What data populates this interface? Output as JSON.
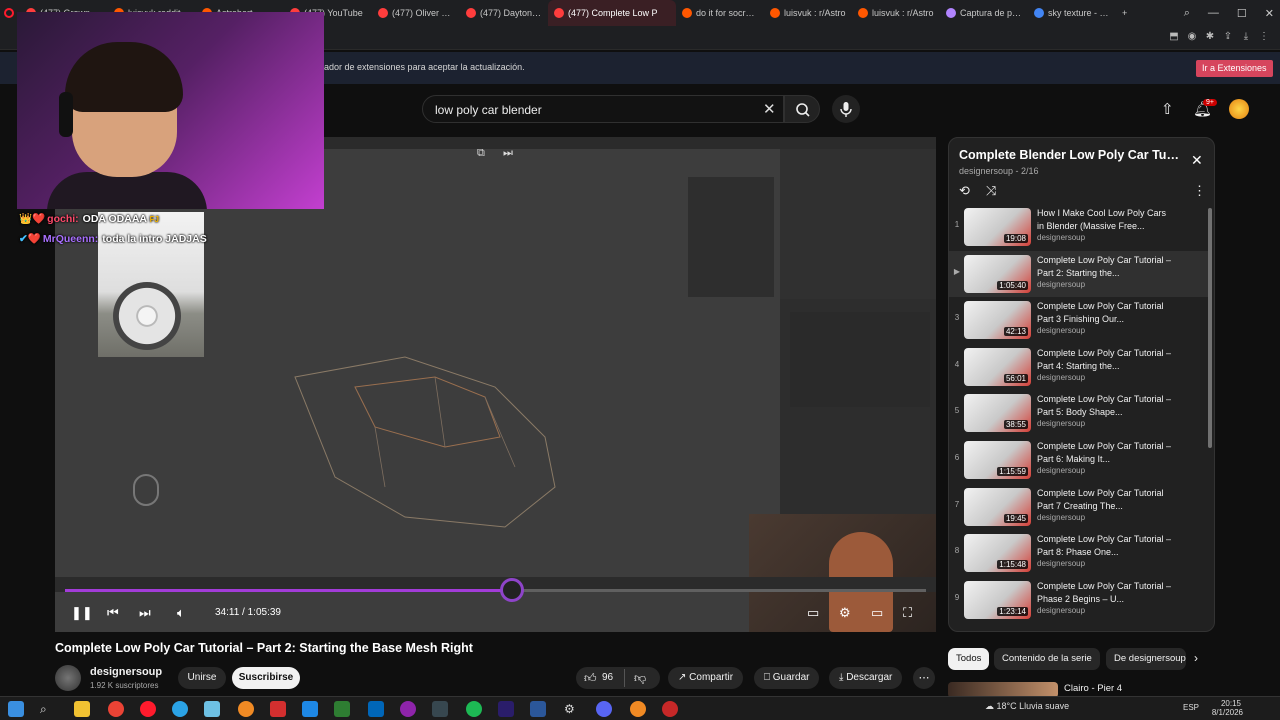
{
  "browser": {
    "tabs": [
      {
        "label": "(477) Grown Up",
        "icon": "youtube-icon",
        "color": "#ff3d3d"
      },
      {
        "label": "luisvuk reddit",
        "icon": "reddit-icon",
        "color": "#ff5700"
      },
      {
        "label": "Astrobort",
        "icon": "reddit-icon",
        "color": "#ff5700"
      },
      {
        "label": "(477) YouTube",
        "icon": "youtube-icon",
        "color": "#ff3d3d"
      },
      {
        "label": "(477) Oliver Tre",
        "icon": "youtube-icon",
        "color": "#ff3d3d"
      },
      {
        "label": "(477) Daytona L",
        "icon": "youtube-icon",
        "color": "#ff3d3d"
      },
      {
        "label": "(477) Complete Low P",
        "icon": "youtube-icon",
        "color": "#ff3d3d",
        "active": true
      },
      {
        "label": "do it for socrate",
        "icon": "reddit-icon",
        "color": "#ff5700"
      },
      {
        "label": "luisvuk : r/Astro",
        "icon": "reddit-icon",
        "color": "#ff5700"
      },
      {
        "label": "luisvuk : r/Astro",
        "icon": "reddit-icon",
        "color": "#ff5700"
      },
      {
        "label": "Captura de pan",
        "icon": "pen-icon",
        "color": "#b184ff"
      },
      {
        "label": "sky texture - Bu",
        "icon": "google-icon",
        "color": "#4285f4"
      }
    ],
    "banner_text": "ador de extensiones para aceptar la actualización.",
    "banner_button": "Ir a Extensiones",
    "accent": "#d6455d"
  },
  "youtube": {
    "search_query": "low poly car blender",
    "notif_count": "9+"
  },
  "stream_overlay": {
    "chat": [
      {
        "badges": "👑❤️",
        "user": "gochi:",
        "user_color": "#ff4a6b",
        "message": "ODA ODAAA",
        "tag": "FJ"
      },
      {
        "badges": "✔❤️",
        "user": "MrQueenn:",
        "user_color": "#a970ff",
        "message": "toda la intro JADJAS",
        "tag": ""
      }
    ]
  },
  "player": {
    "time": "34:11 / 1:05:39",
    "progress": 0.52,
    "progress_color": "#a23cd8"
  },
  "video": {
    "title": "Complete Low Poly Car Tutorial – Part 2: Starting the Base Mesh Right",
    "channel": "designersoup",
    "subscribers": "1.92 K suscriptores",
    "join": "Unirse",
    "subscribe": "Suscribirse",
    "likes": "96",
    "share": "Compartir",
    "save": "Guardar",
    "download": "Descargar"
  },
  "playlist": {
    "title": "Complete Blender Low Poly Car Tuto...",
    "subtitle": "designersoup - 2/16",
    "items": [
      {
        "index": "1",
        "title": "How I Make Cool Low Poly Cars in Blender (Massive Free...",
        "channel": "designersoup",
        "duration": "19:08"
      },
      {
        "index": "▶",
        "title": "Complete Low Poly Car Tutorial – Part 2: Starting the...",
        "channel": "designersoup",
        "duration": "1:05:40",
        "current": true
      },
      {
        "index": "3",
        "title": "Complete Low Poly Car Tutorial Part 3 Finishing Our...",
        "channel": "designersoup",
        "duration": "42:13"
      },
      {
        "index": "4",
        "title": "Complete Low Poly Car Tutorial – Part 4: Starting the...",
        "channel": "designersoup",
        "duration": "56:01"
      },
      {
        "index": "5",
        "title": "Complete Low Poly Car Tutorial – Part 5: Body Shape...",
        "channel": "designersoup",
        "duration": "38:55"
      },
      {
        "index": "6",
        "title": "Complete Low Poly Car Tutorial – Part 6: Making It...",
        "channel": "designersoup",
        "duration": "1:15:59"
      },
      {
        "index": "7",
        "title": "Complete Low Poly Car Tutorial Part 7 Creating The...",
        "channel": "designersoup",
        "duration": "19:45"
      },
      {
        "index": "8",
        "title": "Complete Low Poly Car Tutorial – Part 8: Phase One...",
        "channel": "designersoup",
        "duration": "1:15:48"
      },
      {
        "index": "9",
        "title": "Complete Low Poly Car Tutorial – Phase 2 Begins – U...",
        "channel": "designersoup",
        "duration": "1:23:14"
      }
    ]
  },
  "chips": [
    "Todos",
    "Contenido de la serie",
    "De designersoup"
  ],
  "recommendation": "Clairo - Pier 4",
  "taskbar": {
    "weather": "18°C  Lluvia suave",
    "lang": "ESP",
    "time": "20:15",
    "date": "8/1/2026"
  }
}
